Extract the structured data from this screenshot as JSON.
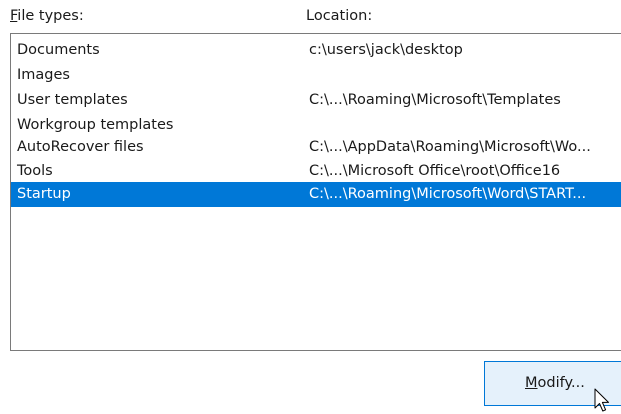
{
  "headers": {
    "file_types_accel": "F",
    "file_types_rest": "ile types:",
    "location": "Location:"
  },
  "rows": [
    {
      "type": "Documents",
      "location": "c:\\users\\jack\\desktop",
      "selected": false
    },
    {
      "type": "Images",
      "location": "",
      "selected": false
    },
    {
      "type": "User templates",
      "location": "C:\\...\\Roaming\\Microsoft\\Templates",
      "selected": false
    },
    {
      "type": "Workgroup templates",
      "location": "",
      "selected": false
    },
    {
      "type": "AutoRecover files",
      "location": "C:\\...\\AppData\\Roaming\\Microsoft\\Wo...",
      "selected": false
    },
    {
      "type": "Tools",
      "location": "C:\\...\\Microsoft Office\\root\\Office16",
      "selected": false
    },
    {
      "type": "Startup",
      "location": "C:\\...\\Roaming\\Microsoft\\Word\\START...",
      "selected": true
    }
  ],
  "modify_button": {
    "accel": "M",
    "rest": "odify..."
  },
  "colors": {
    "selection": "#0078d7",
    "button_face": "#e5f1fb",
    "button_border": "#0078d7"
  },
  "icons": {
    "cursor": "mouse-pointer-icon"
  }
}
